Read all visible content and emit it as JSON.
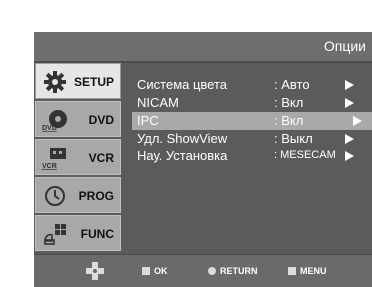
{
  "header": {
    "title": "Опции"
  },
  "sidebar": {
    "items": [
      {
        "label": "SETUP",
        "icon": "gear-icon",
        "active": true
      },
      {
        "label": "DVD",
        "icon": "dvd-icon",
        "active": false
      },
      {
        "label": "VCR",
        "icon": "vcr-icon",
        "active": false
      },
      {
        "label": "PROG",
        "icon": "clock-icon",
        "active": false
      },
      {
        "label": "FUNC",
        "icon": "func-icon",
        "active": false
      }
    ],
    "icon_text": {
      "dvd": "DVD",
      "vcr": "VCR"
    }
  },
  "menu": {
    "rows": [
      {
        "label": "Система цвета",
        "value": ": Авто"
      },
      {
        "label": "NICAM",
        "value": ": Вкл"
      },
      {
        "label": "IPC",
        "value": ": Вкл",
        "selected": true
      },
      {
        "label": "Удл. ShowView",
        "value": ": Выкл"
      },
      {
        "label": "Нау. Установка",
        "value": ": MESECAM"
      }
    ]
  },
  "footer": {
    "ok": "OK",
    "return": "RETURN",
    "menu": "MENU"
  },
  "colors": {
    "panel": "#5b5b5b",
    "selection": "#a9a9a9",
    "title_bar": "#6e6e6e"
  }
}
